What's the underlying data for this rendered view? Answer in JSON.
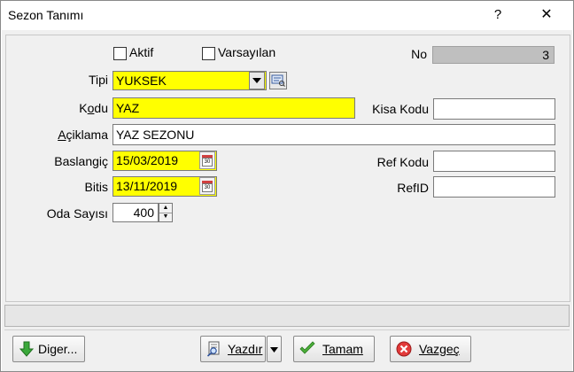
{
  "window": {
    "title": "Sezon Tanımı",
    "help_glyph": "?",
    "close_glyph": "✕"
  },
  "form": {
    "aktif": {
      "label": "Aktif",
      "checked": false
    },
    "varsayilan": {
      "label": "Varsayılan",
      "checked": false
    },
    "no": {
      "label": "No",
      "value": "3"
    },
    "tipi": {
      "label": "Tipi",
      "value": "YUKSEK"
    },
    "kodu": {
      "label_prefix": "K",
      "label_ul": "o",
      "label_suffix": "du",
      "value": "YAZ"
    },
    "kisa_kodu": {
      "label": "Kisa Kodu",
      "value": ""
    },
    "aciklama": {
      "label_prefix": "",
      "label_ul": "A",
      "label_suffix": "çiklama",
      "value": "YAZ SEZONU"
    },
    "baslangic": {
      "label": "Baslangiç",
      "value": "15/03/2019"
    },
    "ref_kodu": {
      "label": "Ref Kodu",
      "value": ""
    },
    "bitis": {
      "label": "Bitis",
      "value": "13/11/2019"
    },
    "ref_id": {
      "label": "RefID",
      "value": ""
    },
    "oda_sayisi": {
      "label": "Oda Sayısı",
      "value": "400"
    },
    "calendar_icon_text": "30"
  },
  "statusbar": {
    "text": ""
  },
  "buttons": {
    "diger": {
      "label": "Diger..."
    },
    "yazdir": {
      "label": "Yazdır"
    },
    "tamam": {
      "label": "Tamam"
    },
    "vazgec": {
      "label": "Vazgeç"
    }
  },
  "icons": {
    "arrow_down": "arrow-down-icon",
    "print_preview": "print-preview-icon",
    "check": "check-icon",
    "cancel": "cancel-icon",
    "calendar": "calendar-icon",
    "lookup": "lookup-icon"
  },
  "colors": {
    "required_field": "#ffff00",
    "readonly_field": "#bfbfbf"
  }
}
